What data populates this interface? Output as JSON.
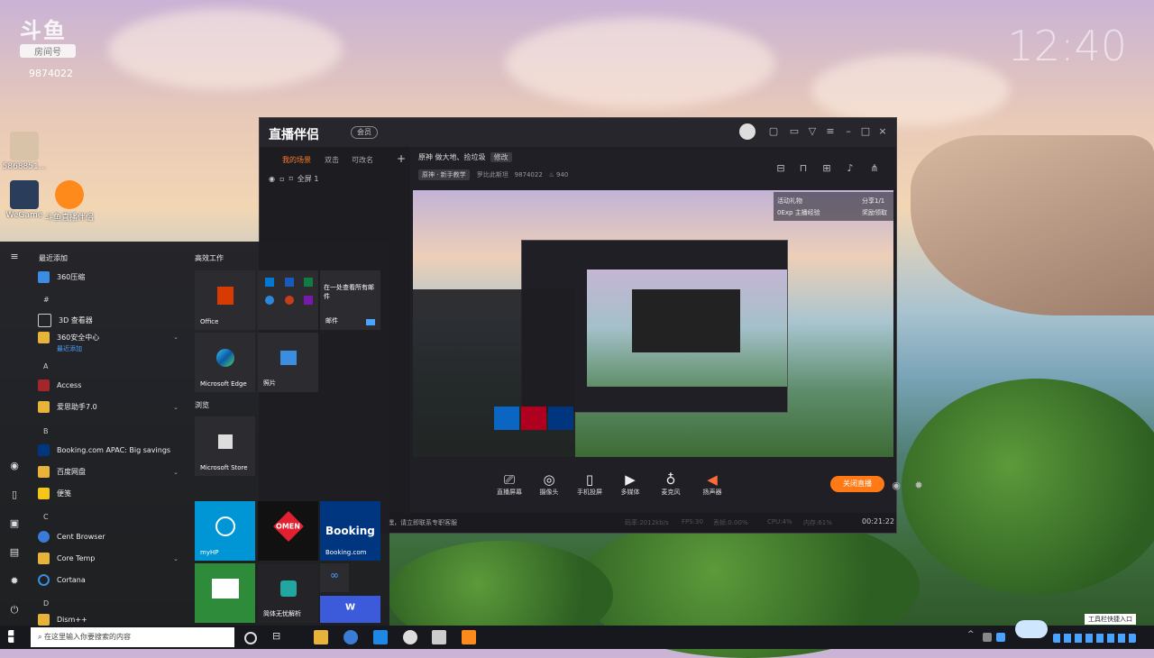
{
  "watermark": {
    "logo": "斗鱼",
    "tag": "房间号",
    "room_number": "9874022"
  },
  "desktop_clock": "12:40",
  "desktop_icons": [
    {
      "label": "5868851..."
    },
    {
      "label": "WeGame"
    },
    {
      "label": "斗鱼直播伴侣"
    }
  ],
  "app": {
    "logo": "直播伴侣",
    "badge": "会员",
    "tabs": [
      "我的场景",
      "双击",
      "可改名"
    ],
    "scene": "全屏 1",
    "room_title": "原神 做大地、捡垃圾",
    "edit": "修改",
    "category": "原神 · 新手教学",
    "streamer": "罗比此斯坦",
    "room_id": "9874022",
    "heat": "940",
    "controls": [
      "直播屏幕",
      "摄像头",
      "手机投屏",
      "多媒体",
      "麦克风",
      "扬声器"
    ],
    "end_button": "关闭直播",
    "status_left": "嘿，请立即联系专职客服",
    "stats": [
      "码率:2012kb/s",
      "FPS:30",
      "丢帧:0.00%",
      "CPU:4%",
      "内存:61%"
    ],
    "timer": "00:21:22",
    "overlay_line1": "活动礼物",
    "overlay_line2": "0Exp 主播经验",
    "overlay_right1": "分享1/1",
    "overlay_right2": "奖励领取"
  },
  "start_menu": {
    "recent_title": "最近添加",
    "items": [
      {
        "label": "360压缩",
        "type": "app"
      },
      {
        "label": "#",
        "type": "letter"
      },
      {
        "label": "3D 查看器",
        "type": "app"
      },
      {
        "label": "360安全中心",
        "sub": "最近添加",
        "type": "folder"
      },
      {
        "label": "A",
        "type": "letter"
      },
      {
        "label": "Access",
        "type": "app"
      },
      {
        "label": "爱思助手7.0",
        "type": "folder"
      },
      {
        "label": "B",
        "type": "letter"
      },
      {
        "label": "Booking.com APAC: Big savings o...",
        "type": "app"
      },
      {
        "label": "百度网盘",
        "type": "folder"
      },
      {
        "label": "便笺",
        "type": "app"
      },
      {
        "label": "C",
        "type": "letter"
      },
      {
        "label": "Cent Browser",
        "type": "app"
      },
      {
        "label": "Core Temp",
        "type": "folder"
      },
      {
        "label": "Cortana",
        "type": "app"
      },
      {
        "label": "D",
        "type": "letter"
      },
      {
        "label": "Dism++",
        "type": "folder"
      }
    ],
    "group1_title": "高效工作",
    "group2_title": "浏览",
    "tiles": {
      "office": "Office",
      "mail_text": "在一处查看所有邮件",
      "mail": "邮件",
      "edge": "Microsoft Edge",
      "photos": "照片",
      "store": "Microsoft Store",
      "myhp": "myHP",
      "omen": "OMEN",
      "booking": "Booking",
      "booking_sub": "Booking.com",
      "solitaire": "",
      "simplysafe": "简体无忧解析",
      "infinity": "",
      "wps": ""
    }
  },
  "taskbar": {
    "search_placeholder": "在这里输入你要搜索的内容",
    "tray_text": "工具栏快捷入口"
  }
}
